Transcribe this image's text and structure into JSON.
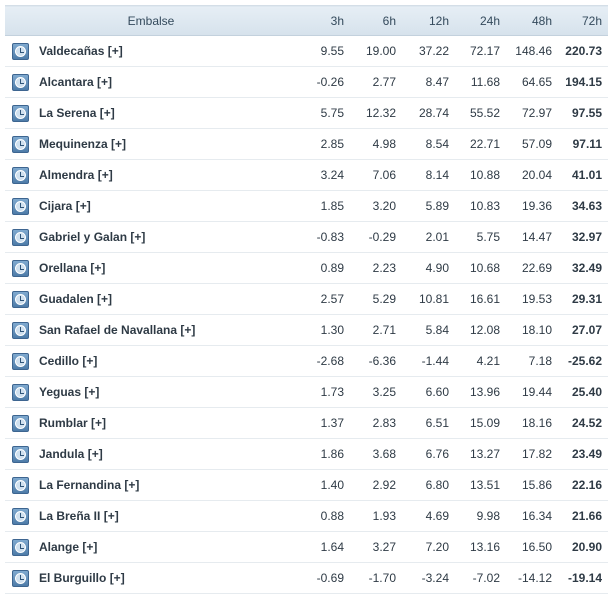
{
  "header": {
    "embalse": "Embalse",
    "h3": "3h",
    "h6": "6h",
    "h12": "12h",
    "h24": "24h",
    "h48": "48h",
    "h72": "72h"
  },
  "expand_label": "[+]",
  "rows": [
    {
      "name": "Valdecañas",
      "v3": "9.55",
      "v6": "19.00",
      "v12": "37.22",
      "v24": "72.17",
      "v48": "148.46",
      "v72": "220.73"
    },
    {
      "name": "Alcantara",
      "v3": "-0.26",
      "v6": "2.77",
      "v12": "8.47",
      "v24": "11.68",
      "v48": "64.65",
      "v72": "194.15"
    },
    {
      "name": "La Serena",
      "v3": "5.75",
      "v6": "12.32",
      "v12": "28.74",
      "v24": "55.52",
      "v48": "72.97",
      "v72": "97.55"
    },
    {
      "name": "Mequinenza",
      "v3": "2.85",
      "v6": "4.98",
      "v12": "8.54",
      "v24": "22.71",
      "v48": "57.09",
      "v72": "97.11"
    },
    {
      "name": "Almendra",
      "v3": "3.24",
      "v6": "7.06",
      "v12": "8.14",
      "v24": "10.88",
      "v48": "20.04",
      "v72": "41.01"
    },
    {
      "name": "Cijara",
      "v3": "1.85",
      "v6": "3.20",
      "v12": "5.89",
      "v24": "10.83",
      "v48": "19.36",
      "v72": "34.63"
    },
    {
      "name": "Gabriel y Galan",
      "v3": "-0.83",
      "v6": "-0.29",
      "v12": "2.01",
      "v24": "5.75",
      "v48": "14.47",
      "v72": "32.97"
    },
    {
      "name": "Orellana",
      "v3": "0.89",
      "v6": "2.23",
      "v12": "4.90",
      "v24": "10.68",
      "v48": "22.69",
      "v72": "32.49"
    },
    {
      "name": "Guadalen",
      "v3": "2.57",
      "v6": "5.29",
      "v12": "10.81",
      "v24": "16.61",
      "v48": "19.53",
      "v72": "29.31"
    },
    {
      "name": "San Rafael de Navallana",
      "v3": "1.30",
      "v6": "2.71",
      "v12": "5.84",
      "v24": "12.08",
      "v48": "18.10",
      "v72": "27.07"
    },
    {
      "name": "Cedillo",
      "v3": "-2.68",
      "v6": "-6.36",
      "v12": "-1.44",
      "v24": "4.21",
      "v48": "7.18",
      "v72": "-25.62"
    },
    {
      "name": "Yeguas",
      "v3": "1.73",
      "v6": "3.25",
      "v12": "6.60",
      "v24": "13.96",
      "v48": "19.44",
      "v72": "25.40"
    },
    {
      "name": "Rumblar",
      "v3": "1.37",
      "v6": "2.83",
      "v12": "6.51",
      "v24": "15.09",
      "v48": "18.16",
      "v72": "24.52"
    },
    {
      "name": "Jandula",
      "v3": "1.86",
      "v6": "3.68",
      "v12": "6.76",
      "v24": "13.27",
      "v48": "17.82",
      "v72": "23.49"
    },
    {
      "name": "La Fernandina",
      "v3": "1.40",
      "v6": "2.92",
      "v12": "6.80",
      "v24": "13.51",
      "v48": "15.86",
      "v72": "22.16"
    },
    {
      "name": "La Breña II",
      "v3": "0.88",
      "v6": "1.93",
      "v12": "4.69",
      "v24": "9.98",
      "v48": "16.34",
      "v72": "21.66"
    },
    {
      "name": "Alange",
      "v3": "1.64",
      "v6": "3.27",
      "v12": "7.20",
      "v24": "13.16",
      "v48": "16.50",
      "v72": "20.90"
    },
    {
      "name": "El Burguillo",
      "v3": "-0.69",
      "v6": "-1.70",
      "v12": "-3.24",
      "v24": "-7.02",
      "v48": "-14.12",
      "v72": "-19.14"
    }
  ]
}
